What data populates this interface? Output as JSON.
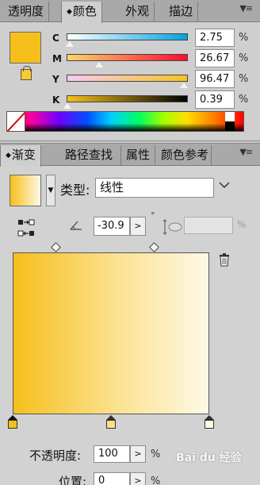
{
  "color_panel": {
    "tabs": [
      {
        "label": "透明度",
        "active": false
      },
      {
        "label": "颜色",
        "active": true
      },
      {
        "label": "外观",
        "active": false
      },
      {
        "label": "描边",
        "active": false
      }
    ],
    "menu_glyph": "▼≡",
    "fill_color": "#f6bf1c",
    "channels": [
      {
        "label": "C",
        "value": "2.75",
        "unit": "%",
        "level": 0.0275,
        "track": "linear-gradient(to right, #ffffff, #00a3e0)"
      },
      {
        "label": "M",
        "value": "26.67",
        "unit": "%",
        "level": 0.2667,
        "track": "linear-gradient(to right, #ffd46b, #ff0a32)"
      },
      {
        "label": "Y",
        "value": "96.47",
        "unit": "%",
        "level": 0.9647,
        "track": "linear-gradient(to right, #f8c9f5, #f7c41c)"
      },
      {
        "label": "K",
        "value": "0.39",
        "unit": "%",
        "level": 0.0039,
        "track": "linear-gradient(to right, #f6bf1c, #000000)"
      }
    ]
  },
  "gradient_panel": {
    "tabs": [
      {
        "label": "渐变",
        "active": true
      },
      {
        "label": "路径查找",
        "active": false
      },
      {
        "label": "属性",
        "active": false
      },
      {
        "label": "颜色参考",
        "active": false
      }
    ],
    "menu_glyph": "▼≡",
    "type_label": "类型:",
    "type_value": "线性",
    "angle": "-30.9",
    "angle_unit": "°",
    "aspect_unit": "%",
    "gradient_start": "#f6bf1c",
    "gradient_end": "#fdf9e6",
    "stops": [
      {
        "color": "#f6bf1c",
        "position": 0
      },
      {
        "color": "#fbe08a",
        "position": 0.5
      },
      {
        "color": "#fdf9e6",
        "position": 1
      }
    ],
    "midpoints": [
      0.22,
      0.72
    ],
    "opacity_label": "不透明度:",
    "opacity_value": "100",
    "opacity_unit": "%",
    "position_label": "位置:",
    "position_value": "0",
    "position_unit": "%"
  },
  "watermark": "Bai du 经验"
}
